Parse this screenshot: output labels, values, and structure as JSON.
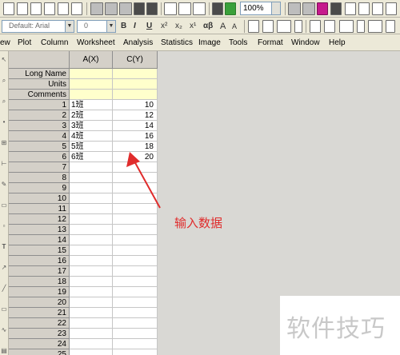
{
  "toolbar": {
    "zoom": "100%",
    "font_name": "Default: Arial",
    "font_size": "0",
    "format_buttons": [
      "B",
      "I",
      "U",
      "x²",
      "x₂",
      "x¹",
      "αβ",
      "A",
      "A"
    ]
  },
  "menu": [
    "ew",
    "Plot",
    "Column",
    "Worksheet",
    "Analysis",
    "Statistics",
    "Image",
    "Tools",
    "Format",
    "Window",
    "Help"
  ],
  "sheet": {
    "columns": [
      "A(X)",
      "C(Y)"
    ],
    "meta_rows": [
      "Long Name",
      "Units",
      "Comments"
    ],
    "row_numbers": [
      "1",
      "2",
      "3",
      "4",
      "5",
      "6",
      "7",
      "8",
      "9",
      "10",
      "11",
      "12",
      "13",
      "14",
      "15",
      "16",
      "17",
      "18",
      "19",
      "20",
      "21",
      "22",
      "23",
      "24",
      "25"
    ],
    "data": [
      {
        "a": "1班",
        "c": "10"
      },
      {
        "a": "2班",
        "c": "12"
      },
      {
        "a": "3班",
        "c": "14"
      },
      {
        "a": "4班",
        "c": "16"
      },
      {
        "a": "5班",
        "c": "18"
      },
      {
        "a": "6班",
        "c": "20"
      }
    ]
  },
  "annotation": "输入数据",
  "watermark": "软件技巧",
  "colors": {
    "accent": "#e02c2c",
    "meta_bg": "#ffffcc"
  }
}
